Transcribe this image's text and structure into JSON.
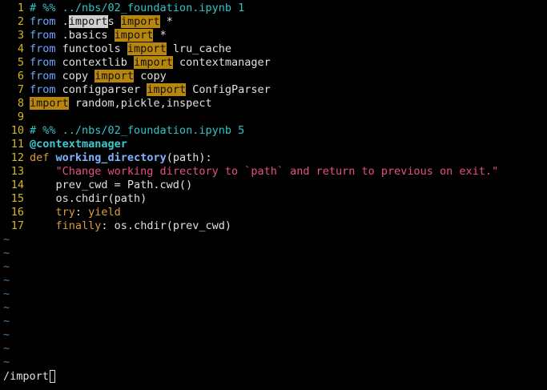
{
  "editor": {
    "lines": [
      {
        "num": "1",
        "segments": [
          {
            "text": "# %% ../nbs/02_foundation.ipynb 1",
            "style": "comment"
          }
        ]
      },
      {
        "num": "2",
        "segments": [
          {
            "text": "from",
            "style": "kw"
          },
          {
            "text": " .",
            "style": "plain"
          },
          {
            "text": "import",
            "style": "hl-cur"
          },
          {
            "text": "s ",
            "style": "plain"
          },
          {
            "text": "import",
            "style": "hl"
          },
          {
            "text": " *",
            "style": "plain"
          }
        ]
      },
      {
        "num": "3",
        "segments": [
          {
            "text": "from",
            "style": "kw"
          },
          {
            "text": " .basics ",
            "style": "plain"
          },
          {
            "text": "import",
            "style": "hl"
          },
          {
            "text": " *",
            "style": "plain"
          }
        ]
      },
      {
        "num": "4",
        "segments": [
          {
            "text": "from",
            "style": "kw"
          },
          {
            "text": " functools ",
            "style": "plain"
          },
          {
            "text": "import",
            "style": "hl"
          },
          {
            "text": " lru_cache",
            "style": "plain"
          }
        ]
      },
      {
        "num": "5",
        "segments": [
          {
            "text": "from",
            "style": "kw"
          },
          {
            "text": " contextlib ",
            "style": "plain"
          },
          {
            "text": "import",
            "style": "hl"
          },
          {
            "text": " contextmanager",
            "style": "plain"
          }
        ]
      },
      {
        "num": "6",
        "segments": [
          {
            "text": "from",
            "style": "kw"
          },
          {
            "text": " copy ",
            "style": "plain"
          },
          {
            "text": "import",
            "style": "hl"
          },
          {
            "text": " copy",
            "style": "plain"
          }
        ]
      },
      {
        "num": "7",
        "segments": [
          {
            "text": "from",
            "style": "kw"
          },
          {
            "text": " configparser ",
            "style": "plain"
          },
          {
            "text": "import",
            "style": "hl"
          },
          {
            "text": " ConfigParser",
            "style": "plain"
          }
        ]
      },
      {
        "num": "8",
        "segments": [
          {
            "text": "import",
            "style": "hl"
          },
          {
            "text": " random,pickle,inspect",
            "style": "plain"
          }
        ]
      },
      {
        "num": "9",
        "segments": []
      },
      {
        "num": "10",
        "segments": [
          {
            "text": "# %% ../nbs/02_foundation.ipynb 5",
            "style": "comment"
          }
        ]
      },
      {
        "num": "11",
        "segments": [
          {
            "text": "@contextmanager",
            "style": "deco"
          }
        ]
      },
      {
        "num": "12",
        "segments": [
          {
            "text": "def",
            "style": "def"
          },
          {
            "text": " ",
            "style": "plain"
          },
          {
            "text": "working_directory",
            "style": "fn"
          },
          {
            "text": "(path):",
            "style": "plain"
          }
        ]
      },
      {
        "num": "13",
        "segments": [
          {
            "text": "    ",
            "style": "plain"
          },
          {
            "text": "\"Change working directory to `path` and return to previous on exit.\"",
            "style": "str"
          }
        ]
      },
      {
        "num": "14",
        "segments": [
          {
            "text": "    prev_cwd = Path.cwd()",
            "style": "plain"
          }
        ]
      },
      {
        "num": "15",
        "segments": [
          {
            "text": "    os.chdir(path)",
            "style": "plain"
          }
        ]
      },
      {
        "num": "16",
        "segments": [
          {
            "text": "    ",
            "style": "plain"
          },
          {
            "text": "try",
            "style": "def"
          },
          {
            "text": ": ",
            "style": "plain"
          },
          {
            "text": "yield",
            "style": "yield"
          }
        ]
      },
      {
        "num": "17",
        "segments": [
          {
            "text": "    ",
            "style": "plain"
          },
          {
            "text": "finally",
            "style": "def"
          },
          {
            "text": ": os.chdir(prev_cwd)",
            "style": "plain"
          }
        ]
      }
    ],
    "tilde_glyph": "~",
    "tilde_count": 10
  },
  "cmdline": {
    "text": "/import"
  },
  "colors": {
    "background": "#000000",
    "line_number": "#d4b81d",
    "comment": "#33c3c8",
    "keyword": "#6ea6ff",
    "search_highlight": "#b8860b",
    "string": "#e64f8a",
    "tilde": "#4a7aa3"
  }
}
